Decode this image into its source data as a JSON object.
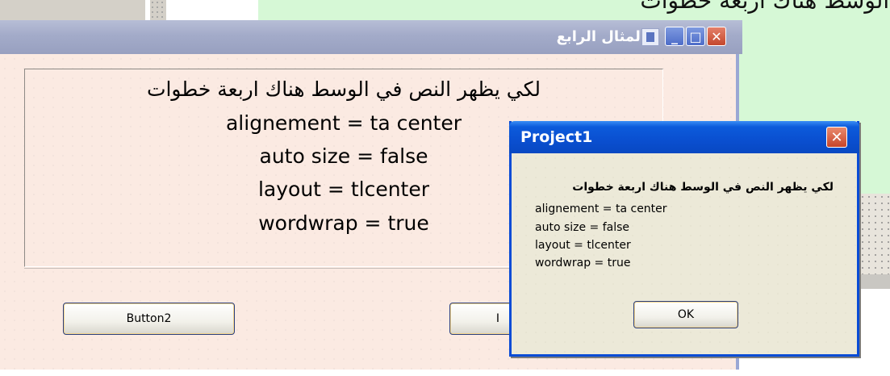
{
  "background": {
    "label_text": "لكي يظهر النص في الوسط هناك اربعة خطوات"
  },
  "form": {
    "title": "المثال الرابع",
    "title_buttons": {
      "close": "✕",
      "maximize": "□",
      "minimize": "_"
    },
    "label_lines": [
      "لكي يظهر النص في الوسط هناك اربعة خطوات",
      "alignement = ta center",
      "auto size = false",
      "layout = tlcenter",
      "wordwrap = true"
    ],
    "buttons": {
      "button2": "Button2",
      "hidden_button": "I"
    }
  },
  "msgbox": {
    "title": "Project1",
    "close": "✕",
    "lines": [
      "لكي يظهر النص في الوسط هناك اربعة خطوات",
      " alignement = ta center",
      "auto size = false",
      "layout = tlcenter",
      "wordwrap = true"
    ],
    "ok_label": "OK"
  },
  "colors": {
    "form_client": "#fbeae2",
    "msg_title": "#0a4fd0",
    "msg_body": "#ece9d8",
    "background_green": "#d6f8d6"
  }
}
